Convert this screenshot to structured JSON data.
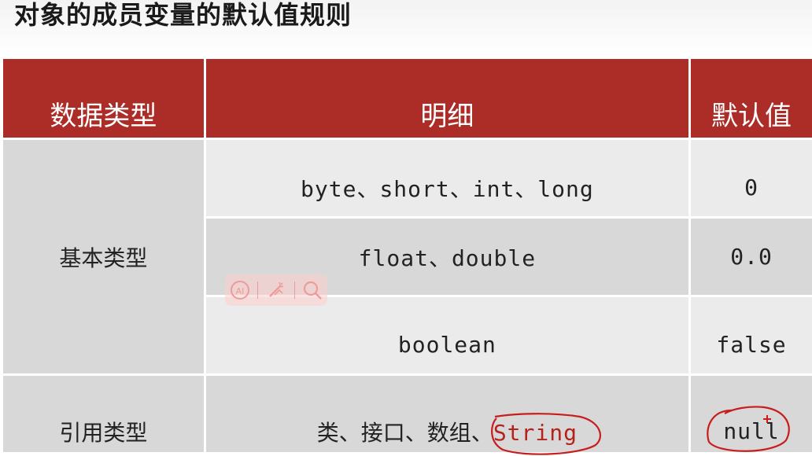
{
  "page": {
    "title": "对象的成员变量的默认值规则"
  },
  "table": {
    "headers": [
      "数据类型",
      "明细",
      "默认值"
    ],
    "groups": [
      {
        "label": "基本类型"
      },
      {
        "label": "引用类型"
      }
    ],
    "rows": [
      {
        "detail": "byte、short、int、long",
        "default": "0"
      },
      {
        "detail": "float、double",
        "default": "0.0"
      },
      {
        "detail": "boolean",
        "default": "false"
      },
      {
        "detail_prefix": "类、接口、数组、",
        "detail_highlight": "String",
        "default": "null"
      }
    ]
  },
  "colors": {
    "header_bg": "#ac2d28",
    "header_text": "#ffffff",
    "cell_light": "#ebebeb",
    "cell_mid": "#d8d8d8",
    "annotation": "#b5221b"
  },
  "floating_toolbar": {
    "icons": [
      "ai-icon",
      "magic-wand-icon",
      "search-icon"
    ]
  }
}
